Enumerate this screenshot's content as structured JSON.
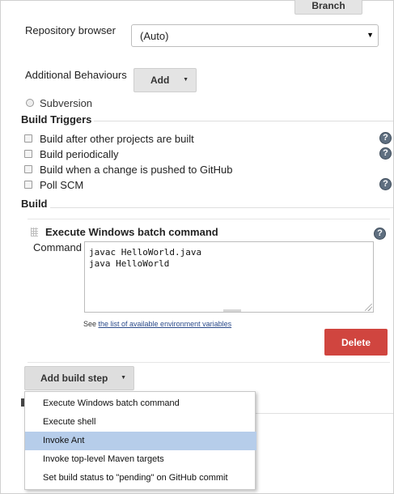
{
  "branch_button": "Branch",
  "repository_browser": {
    "label": "Repository browser",
    "value": "(Auto)"
  },
  "additional_behaviours": {
    "label": "Additional Behaviours",
    "add_button": "Add"
  },
  "subversion": {
    "label": "Subversion"
  },
  "build_triggers": {
    "title": "Build Triggers",
    "options": [
      "Build after other projects are built",
      "Build periodically",
      "Build when a change is pushed to GitHub",
      "Poll SCM"
    ]
  },
  "build": {
    "title": "Build",
    "step_title": "Execute Windows batch command",
    "command_label": "Command",
    "command_value": "javac HelloWorld.java\njava HelloWorld",
    "see_prefix": "See ",
    "see_link": "the list of available environment variables",
    "delete_button": "Delete",
    "add_build_step": "Add build step"
  },
  "dropdown_menu": {
    "items": [
      "Execute Windows batch command",
      "Execute shell",
      "Invoke Ant",
      "Invoke top-level Maven targets",
      "Set build status to \"pending\" on GitHub commit"
    ],
    "highlighted_index": 2
  },
  "icons": {
    "help": "help-icon",
    "dropdown": "chevron-down-icon",
    "resize": "resize-grip-icon"
  },
  "colors": {
    "delete": "#d0453f",
    "menu_highlight": "#b6cdea",
    "link": "#2a4a8a"
  }
}
